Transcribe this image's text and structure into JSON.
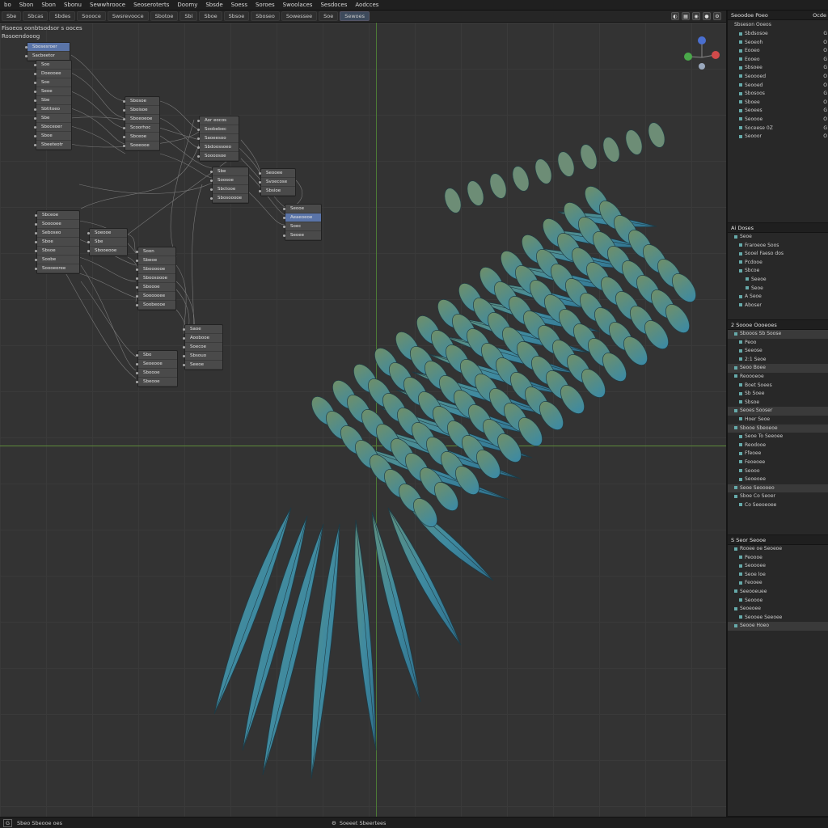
{
  "menubar": {
    "items": [
      "bo",
      "Sbon",
      "Sbon",
      "Sbonu",
      "Sewwhrooce",
      "Seoseroterts",
      "Doomy",
      "Sbsde",
      "Soess",
      "Soroes",
      "Swoolaces",
      "Sesdoces",
      "Aodcces"
    ]
  },
  "toolbar": {
    "tabs": [
      "Sbe",
      "Sbcas",
      "Sbdes",
      "Soooce",
      "Swsrevooce",
      "Sbotoe",
      "Sbi",
      "Sboe",
      "Sbsoe",
      "Sboseo",
      "Sowessee",
      "Soe",
      "Sewoes"
    ],
    "active_index": 12
  },
  "viewport": {
    "title_line1": "Fisoeos oonbtsodsor s ooces",
    "title_line2": "Rosoendooog",
    "nodes": [
      {
        "rows": [
          "Sbosesroer",
          "Sacbeetor"
        ],
        "sel": 0
      },
      {
        "rows": [
          "Soo",
          "Doeooee",
          "Soo",
          "Seoe",
          "Sbe",
          "Sbtitoeo",
          "Sbe",
          "Sboceoer",
          "Sboe",
          "Sbeeteotr"
        ],
        "sel": -1
      },
      {
        "rows": [
          "Sbosoe",
          "Sboisoe",
          "Sboeoeoe",
          "Scoorhoc",
          "Sbceoe",
          "Sooeooe"
        ],
        "sel": -1
      },
      {
        "rows": [
          "Aor eocos",
          "Soobebec",
          "Saoeesoo",
          "Sbdoossoeo",
          "Soooosoe"
        ],
        "sel": -1
      },
      {
        "rows": [
          "Sbe",
          "Soosoe",
          "Sbctooe",
          "Sbosooooe"
        ],
        "sel": -1
      },
      {
        "rows": [
          "Seooee",
          "Svoecose",
          "Sbsioe"
        ],
        "sel": -1
      },
      {
        "rows": [
          "Seooe",
          "Aeaeoeoe",
          "Soec",
          "Seoee"
        ],
        "sel": 1
      },
      {
        "rows": [
          "Sbceoe",
          "Sooooee",
          "Seboseo",
          "Sboe",
          "Sbsoe",
          "Soobe",
          "Soooeoree"
        ],
        "sel": -1
      },
      {
        "rows": [
          "Soeooe",
          "Sbe",
          "Sbooeooe"
        ],
        "sel": -1
      },
      {
        "rows": [
          "Soon",
          "Sbeoe",
          "Sboooooe",
          "Sboosoooe",
          "Sboooe",
          "Soooooee",
          "Soobeooe"
        ],
        "sel": -1
      },
      {
        "rows": [
          "Saoe",
          "Aoobooe",
          "Soecoe",
          "Sbsouo",
          "Seeoe"
        ],
        "sel": -1
      },
      {
        "rows": [
          "Sbo",
          "Seoeooe",
          "Sboooe",
          "Sbeooe"
        ],
        "sel": -1
      }
    ]
  },
  "sidebar": {
    "outliner": {
      "header": "Seoodoe Poeo",
      "header_icon": "Ocde",
      "title": "Sbseson Ooeos",
      "items": [
        {
          "label": "Sbdsosoe",
          "val": "G"
        },
        {
          "label": "Seoeoh",
          "val": "O"
        },
        {
          "label": "Eooeo",
          "val": "O"
        },
        {
          "label": "Eooeo",
          "val": "G"
        },
        {
          "label": "Sbsoee",
          "val": "G"
        },
        {
          "label": "Seoooed",
          "val": "O"
        },
        {
          "label": "Seooed",
          "val": "O"
        },
        {
          "label": "Sbosoos",
          "val": "G"
        },
        {
          "label": "Sboee",
          "val": "O"
        },
        {
          "label": "Seoees",
          "val": "G"
        },
        {
          "label": "Seoooe",
          "val": "O"
        },
        {
          "label": "Soceese 0Z",
          "val": "G"
        },
        {
          "label": "Seooor",
          "val": "O"
        }
      ]
    },
    "props": {
      "header": "Ai Doses",
      "rows": [
        {
          "label": "Seoe",
          "cls": "top"
        },
        {
          "label": "Fraroeoe Soos",
          "cls": "sub"
        },
        {
          "label": "Sooel Faeso dos",
          "cls": "sub"
        },
        {
          "label": "Pcdooe",
          "cls": "sub"
        },
        {
          "label": "Sbcoe",
          "cls": "sub"
        },
        {
          "label": "Seeoe",
          "cls": "sub2"
        },
        {
          "label": "Seoe",
          "cls": "sub2"
        },
        {
          "label": "A Seoe",
          "cls": "sub"
        },
        {
          "label": "Aboser",
          "cls": "sub"
        }
      ]
    },
    "panel3": {
      "header": "2 Soooe Oooeoes",
      "rows": [
        {
          "label": "Sbooos Sb Soose",
          "cls": "top hl"
        },
        {
          "label": "Peoo",
          "cls": "sub"
        },
        {
          "label": "Seeose",
          "cls": "sub"
        },
        {
          "label": "2:1 Seoe",
          "cls": "sub"
        },
        {
          "label": "Seoo Boee",
          "cls": "top hl"
        },
        {
          "label": "Reoooeoe",
          "cls": "top"
        },
        {
          "label": "Boet Soees",
          "cls": "sub"
        },
        {
          "label": "Sb Soee",
          "cls": "sub"
        },
        {
          "label": "Sbsoe",
          "cls": "sub"
        },
        {
          "label": "Seoes Sooser",
          "cls": "top hl"
        },
        {
          "label": "Hoer Seoe",
          "cls": "sub"
        },
        {
          "label": "Sbooe Sbeoeoe",
          "cls": "top hl"
        },
        {
          "label": "Seoe To Seeoee",
          "cls": "sub"
        },
        {
          "label": "Reodooe",
          "cls": "sub"
        },
        {
          "label": "Ffeoee",
          "cls": "sub"
        },
        {
          "label": "Feoeoee",
          "cls": "sub"
        },
        {
          "label": "Seooo",
          "cls": "sub"
        },
        {
          "label": "Seoeoee",
          "cls": "sub"
        },
        {
          "label": "Seoe Seoooeo",
          "cls": "top hl"
        },
        {
          "label": "Sboe Co Seoer",
          "cls": "top"
        },
        {
          "label": "Co Seeoeoee",
          "cls": "sub"
        }
      ]
    },
    "panel4": {
      "header": "S Seor Seooe",
      "rows": [
        {
          "label": "Rooee oe Seoeoe",
          "cls": "top"
        },
        {
          "label": "Peoooe",
          "cls": "sub"
        },
        {
          "label": "Seoooee",
          "cls": "sub"
        },
        {
          "label": "Seoe loe",
          "cls": "sub"
        },
        {
          "label": "Feooee",
          "cls": "sub"
        },
        {
          "label": "Seeooeuee",
          "cls": "top"
        },
        {
          "label": "Seoooe",
          "cls": "sub"
        },
        {
          "label": "Seoeoee",
          "cls": "top"
        },
        {
          "label": "Seooee Seeoee",
          "cls": "sub"
        },
        {
          "label": "Seooe Hoeo",
          "cls": "top hl"
        }
      ]
    }
  },
  "statusbar": {
    "left_icon": "G",
    "left_text": "Sbeo Sbeooe oes",
    "center_text": "Soeeet Sbeertees"
  },
  "gizmo": {
    "x_color": "#d04a4a",
    "y_color": "#4aa84a",
    "z_color": "#4a6fd0"
  }
}
